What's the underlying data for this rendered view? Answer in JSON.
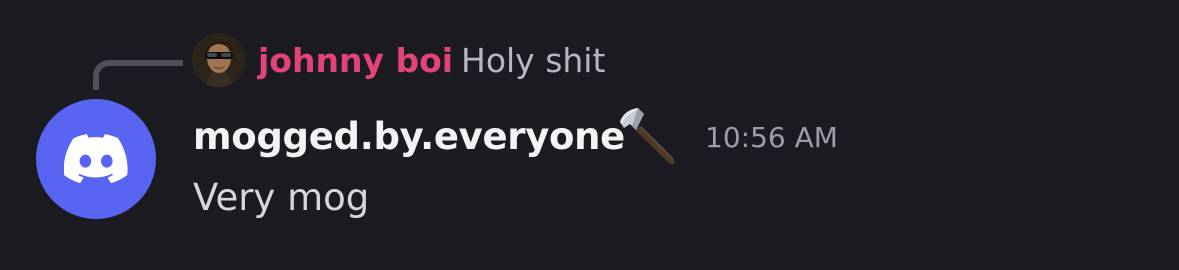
{
  "reply": {
    "author": "johnny boi",
    "text": "Holy shit",
    "author_color": "#e34379"
  },
  "message": {
    "author": "mogged.by.everyone",
    "role_icon": "hammer-icon",
    "timestamp": "10:56 AM",
    "content": "Very mog"
  },
  "colors": {
    "background": "#1b1b21",
    "avatar_bg": "#5865f2",
    "reply_spine": "#4e5058"
  },
  "icons": {
    "avatar": "discord-logo-icon",
    "reply_avatar": "user-avatar-icon"
  }
}
